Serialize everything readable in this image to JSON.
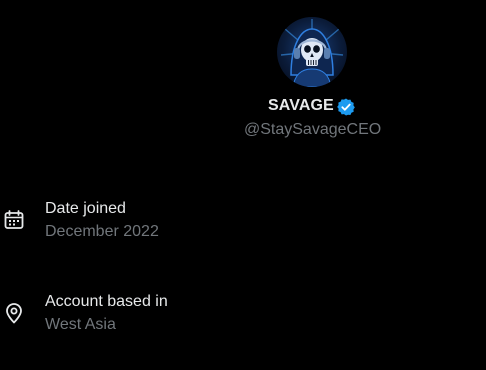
{
  "profile": {
    "display_name": "SAVAGE",
    "handle": "@StaySavageCEO",
    "verified": true,
    "avatar_icon": "skull-avatar",
    "accent_color": "#1d9bf0"
  },
  "about": {
    "joined": {
      "label": "Date joined",
      "value": "December 2022",
      "icon": "calendar-icon"
    },
    "location": {
      "label": "Account based in",
      "value": "West Asia",
      "icon": "location-pin-icon"
    }
  },
  "colors": {
    "background": "#000000",
    "primary_text": "#e7e9ea",
    "secondary_text": "#71767b",
    "verified_badge": "#1d9bf0"
  }
}
